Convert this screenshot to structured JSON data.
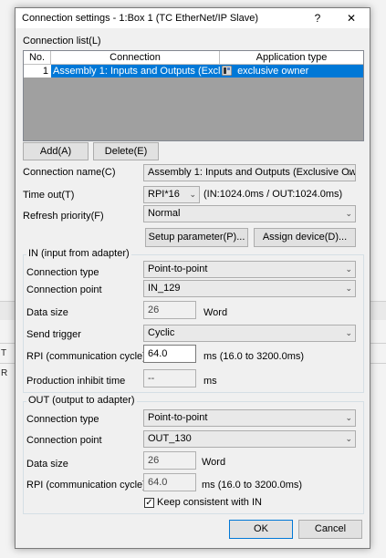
{
  "background": {
    "frag_1": "T",
    "frag_2": "R"
  },
  "dialog": {
    "title": "Connection settings  - 1:Box 1 (TC EtherNet/IP Slave)",
    "help_label": "?",
    "close_label": "✕"
  },
  "connection_list": {
    "label": "Connection list(L)",
    "columns": [
      "No.",
      "Connection",
      "Application type"
    ],
    "rows": [
      {
        "no": "1",
        "connection": "Assembly 1: Inputs and Outputs (Excl...",
        "application_type": "exclusive owner"
      }
    ]
  },
  "list_buttons": {
    "add": "Add(A)",
    "delete": "Delete(E)"
  },
  "connection_name": {
    "label": "Connection name(C)",
    "value": "Assembly 1: Inputs and Outputs (Exclusive Ow"
  },
  "timeout": {
    "label": "Time out(T)",
    "value": "RPI*16",
    "info": "(IN:1024.0ms / OUT:1024.0ms)"
  },
  "refresh_priority": {
    "label": "Refresh priority(F)",
    "value": "Normal"
  },
  "param_buttons": {
    "setup": "Setup parameter(P)...",
    "assign": "Assign device(D)..."
  },
  "in_group": {
    "title": "IN (input from adapter)",
    "connection_type_label": "Connection type",
    "connection_type": "Point-to-point",
    "connection_point_label": "Connection point",
    "connection_point": "IN_129",
    "data_size_label": "Data size",
    "data_size": "26",
    "data_size_unit": "Word",
    "send_trigger_label": "Send trigger",
    "send_trigger": "Cyclic",
    "rpi_label": "RPI (communication cycle)",
    "rpi": "64.0",
    "rpi_unit": "ms  (16.0 to 3200.0ms)",
    "inhibit_label": "Production inhibit time",
    "inhibit": "--",
    "inhibit_unit": "ms"
  },
  "out_group": {
    "title": "OUT (output to adapter)",
    "connection_type_label": "Connection type",
    "connection_type": "Point-to-point",
    "connection_point_label": "Connection point",
    "connection_point": "OUT_130",
    "data_size_label": "Data size",
    "data_size": "26",
    "data_size_unit": "Word",
    "rpi_label": "RPI (communication cycle)",
    "rpi": "64.0",
    "rpi_unit": "ms  (16.0 to 3200.0ms)",
    "keep_label": "Keep consistent with IN",
    "keep_checked": true
  },
  "footer": {
    "ok": "OK",
    "cancel": "Cancel"
  },
  "colors": {
    "selection": "#0078d7",
    "list_background": "#a0a0a0"
  }
}
